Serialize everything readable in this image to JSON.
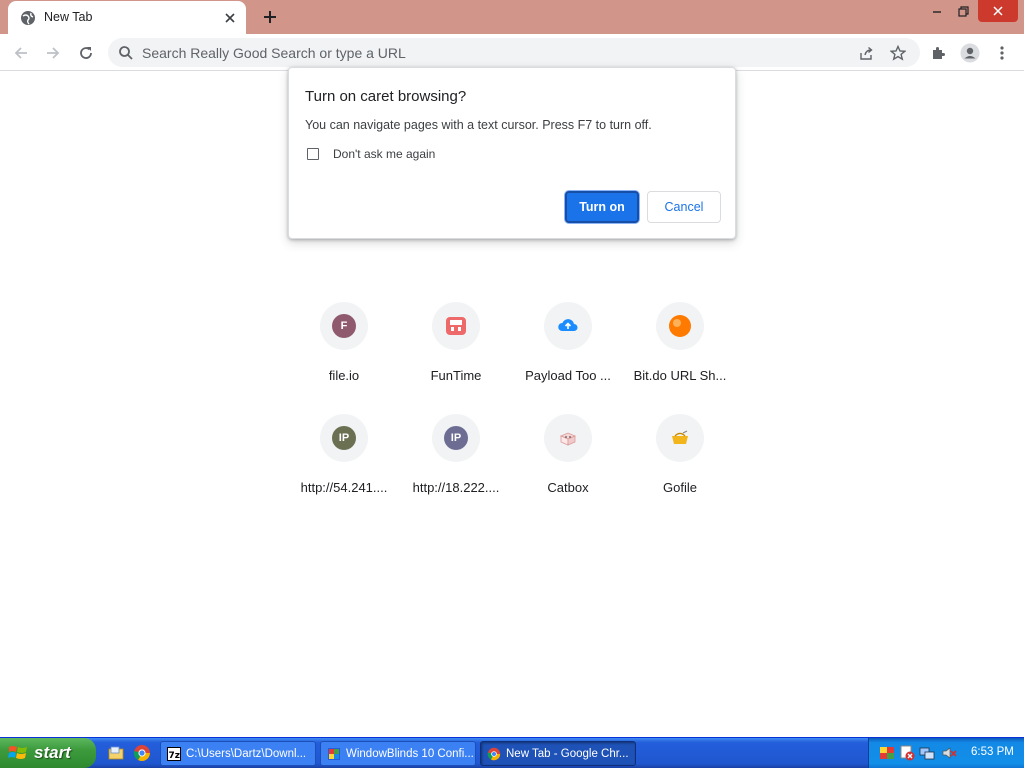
{
  "browser": {
    "tab": {
      "title": "New Tab"
    },
    "omnibox": {
      "placeholder": "Search Really Good Search or type a URL"
    }
  },
  "dialog": {
    "title": "Turn on caret browsing?",
    "body": "You can navigate pages with a text cursor. Press F7 to turn off.",
    "checkbox_label": "Don't ask me again",
    "primary_label": "Turn on",
    "secondary_label": "Cancel"
  },
  "shortcuts": [
    {
      "label": "file.io",
      "icon": "letter",
      "letter": "F",
      "color": "#8f5a6e"
    },
    {
      "label": "FunTime",
      "icon": "store-icon",
      "color": "#ee6a6a"
    },
    {
      "label": "Payload Too ...",
      "icon": "cloud-upload-icon",
      "color": "#1a8cff"
    },
    {
      "label": "Bit.do URL Sh...",
      "icon": "orange-ball-icon",
      "color": "#ff7a00"
    },
    {
      "label": "http://54.241....",
      "icon": "letter",
      "letter": "IP",
      "color": "#6b7052"
    },
    {
      "label": "http://18.222....",
      "icon": "letter",
      "letter": "IP",
      "color": "#6d6d94"
    },
    {
      "label": "Catbox",
      "icon": "catbox-icon",
      "color": "#e8a0a0"
    },
    {
      "label": "Gofile",
      "icon": "gofile-icon",
      "color": "#f2b51c"
    }
  ],
  "taskbar": {
    "start_label": "start",
    "tasks": [
      {
        "label": "C:\\Users\\Dartz\\Downl...",
        "icon": "7zip-icon"
      },
      {
        "label": "WindowBlinds 10 Confi...",
        "icon": "windowblinds-icon"
      },
      {
        "label": "New Tab - Google Chr...",
        "icon": "chrome-icon",
        "active": true
      }
    ],
    "clock": "6:53 PM"
  }
}
